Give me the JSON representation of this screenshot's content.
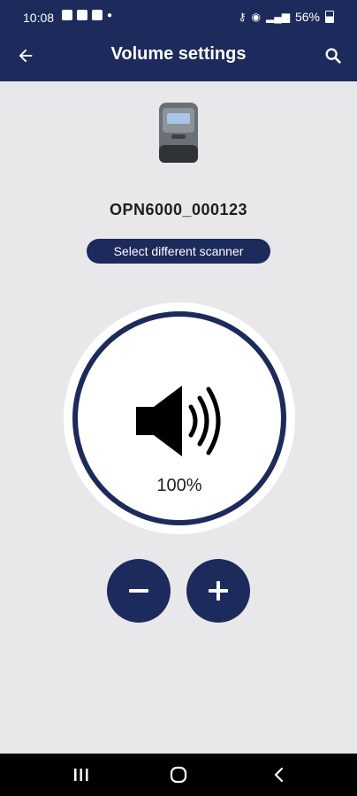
{
  "status_bar": {
    "time": "10:08",
    "battery_percent": "56%"
  },
  "app_bar": {
    "title": "Volume settings",
    "back_icon": "arrow-left-icon",
    "search_icon": "search-icon"
  },
  "device": {
    "name": "OPN6000_000123",
    "select_button_label": "Select different scanner"
  },
  "volume": {
    "level_percent": 100,
    "label": "100%"
  },
  "controls": {
    "decrease_icon": "minus-icon",
    "increase_icon": "plus-icon"
  },
  "nav_bar": {
    "recent_icon": "recent-apps-icon",
    "home_icon": "home-icon",
    "back_icon": "back-chevron-icon"
  },
  "colors": {
    "primary": "#1c2b5b",
    "background": "#e8e8ea",
    "surface": "#ffffff"
  }
}
